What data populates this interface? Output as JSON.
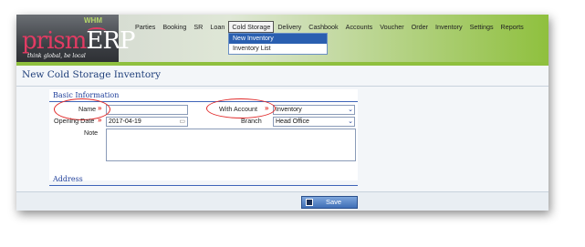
{
  "app": {
    "logo_brand_main": "prism",
    "logo_brand_accent": "ERP",
    "logo_badge": "WHM",
    "logo_tagline": "think global, be local"
  },
  "menu": {
    "items": [
      {
        "label": "Parties"
      },
      {
        "label": "Booking"
      },
      {
        "label": "SR"
      },
      {
        "label": "Loan"
      },
      {
        "label": "Cold Storage"
      },
      {
        "label": "Delivery"
      },
      {
        "label": "Cashbook"
      },
      {
        "label": "Accounts"
      },
      {
        "label": "Voucher"
      },
      {
        "label": "Order"
      },
      {
        "label": "Inventory"
      },
      {
        "label": "Settings"
      },
      {
        "label": "Reports"
      }
    ],
    "active": "Cold Storage",
    "dropdown": [
      {
        "label": "New Inventory",
        "selected": true
      },
      {
        "label": "Inventory List",
        "selected": false
      }
    ]
  },
  "page": {
    "title": "New Cold Storage Inventory",
    "basic_section": "Basic Information",
    "address_section": "Address"
  },
  "form": {
    "name_label": "Name",
    "name_value": "",
    "opening_date_label": "Opening Date",
    "opening_date_value": "2017-04-19",
    "note_label": "Note",
    "note_value": "",
    "with_account_label": "With Account",
    "with_account_value": "Inventory",
    "branch_label": "Branch",
    "branch_value": "Head Office",
    "required_marker": "»"
  },
  "actions": {
    "save_label": "Save"
  },
  "colors": {
    "accent_blue": "#1f3f9a",
    "annotation_red": "#e12a2a",
    "header_green": "#8fc03e",
    "brand_pink": "#e23b63"
  },
  "icons": {
    "save": "floppy-disk-icon",
    "calendar": "calendar-icon",
    "select": "chevron-down-icon"
  }
}
